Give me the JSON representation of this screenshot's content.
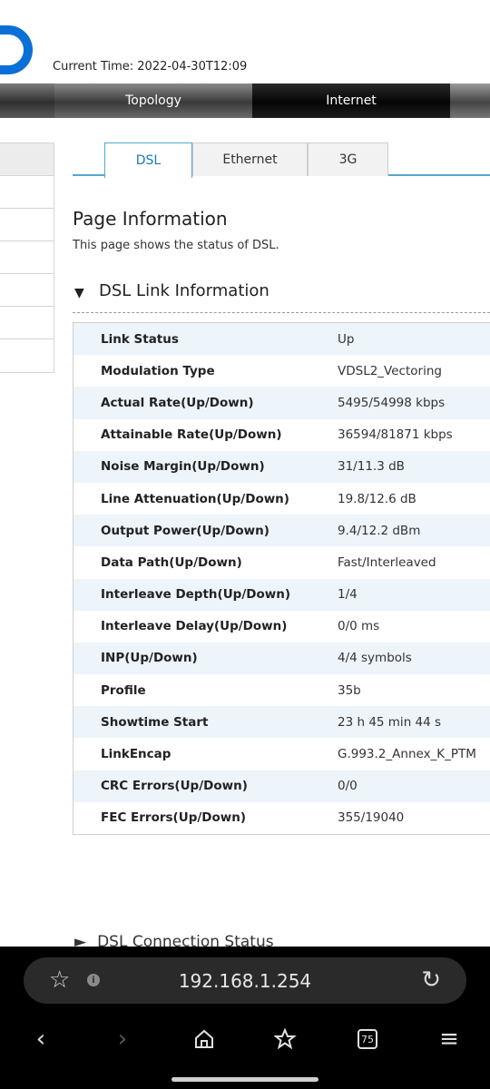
{
  "header": {
    "current_time_label": "Current Time: 2022-04-30T12:09"
  },
  "nav": {
    "topology": "Topology",
    "internet": "Internet"
  },
  "tabs": {
    "dsl": "DSL",
    "ethernet": "Ethernet",
    "g3": "3G"
  },
  "page": {
    "title": "Page Information",
    "description": "This page shows the status of DSL."
  },
  "section": {
    "title": "DSL Link Information",
    "next_title": "DSL Connection Status"
  },
  "rows": [
    {
      "label": "Link Status",
      "value": "Up"
    },
    {
      "label": "Modulation Type",
      "value": "VDSL2_Vectoring"
    },
    {
      "label": "Actual Rate(Up/Down)",
      "value": "5495/54998 kbps"
    },
    {
      "label": "Attainable Rate(Up/Down)",
      "value": "36594/81871 kbps"
    },
    {
      "label": "Noise Margin(Up/Down)",
      "value": "31/11.3 dB"
    },
    {
      "label": "Line Attenuation(Up/Down)",
      "value": "19.8/12.6 dB"
    },
    {
      "label": "Output Power(Up/Down)",
      "value": "9.4/12.2 dBm"
    },
    {
      "label": "Data Path(Up/Down)",
      "value": "Fast/Interleaved"
    },
    {
      "label": "Interleave Depth(Up/Down)",
      "value": "1/4"
    },
    {
      "label": "Interleave Delay(Up/Down)",
      "value": "0/0 ms"
    },
    {
      "label": "INP(Up/Down)",
      "value": "4/4 symbols"
    },
    {
      "label": "Profile",
      "value": "35b"
    },
    {
      "label": "Showtime Start",
      "value": "23 h 45 min 44 s"
    },
    {
      "label": "LinkEncap",
      "value": "G.993.2_Annex_K_PTM"
    },
    {
      "label": "CRC Errors(Up/Down)",
      "value": "0/0"
    },
    {
      "label": "FEC Errors(Up/Down)",
      "value": "355/19040"
    }
  ],
  "browser": {
    "url": "192.168.1.254",
    "tabs_count": "75"
  },
  "colors": {
    "accent": "#56a7d1",
    "logo": "#0a6fd6",
    "row_alt": "#edf4fa"
  }
}
